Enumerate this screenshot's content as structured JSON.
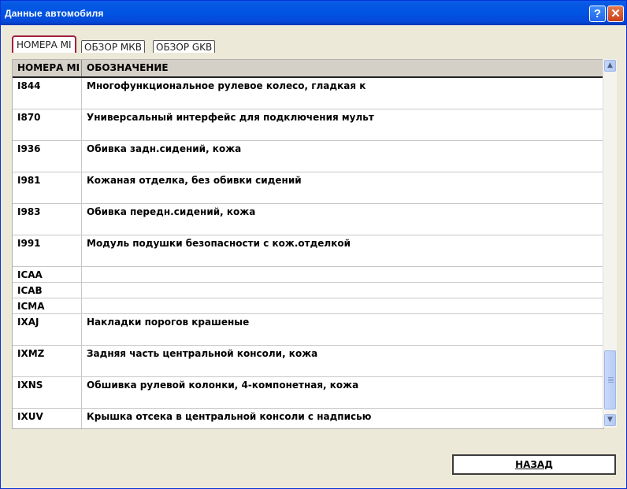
{
  "window": {
    "title": "Данные автомобиля",
    "help_label": "?",
    "close_label": "✕"
  },
  "tabs": [
    {
      "label": "НОМЕРА МI",
      "active": true
    },
    {
      "label": "ОБЗОР МКВ",
      "active": false
    },
    {
      "label": "ОБЗОР GKB",
      "active": false
    }
  ],
  "table": {
    "columns": [
      "НОМЕРА МI",
      "ОБОЗНАЧЕНИЕ"
    ],
    "rows": [
      {
        "code": "I844",
        "desc": "Многофункциональное рулевое колесо, гладкая к"
      },
      {
        "code": "I870",
        "desc": "Универсальный интерфейс для подключения мульт"
      },
      {
        "code": "I936",
        "desc": "Обивка задн.сидений, кожа"
      },
      {
        "code": "I981",
        "desc": "Кожаная отделка, без обивки сидений"
      },
      {
        "code": "I983",
        "desc": "Обивка передн.сидений, кожа"
      },
      {
        "code": "I991",
        "desc": "Модуль подушки безопасности с кож.отделкой"
      },
      {
        "code": "ICAA",
        "desc": ""
      },
      {
        "code": "ICAB",
        "desc": ""
      },
      {
        "code": "ICMA",
        "desc": ""
      },
      {
        "code": "IXAJ",
        "desc": "Накладки порогов крашеные"
      },
      {
        "code": "IXMZ",
        "desc": "Задняя часть центральной консоли, кожа"
      },
      {
        "code": "IXNS",
        "desc": "Обшивка рулевой колонки, 4-компонетная, кожа"
      },
      {
        "code": "IXUV",
        "desc": "Крышка отсека в центральной консоли с надписью"
      }
    ]
  },
  "footer": {
    "back_label": "НАЗАД"
  }
}
